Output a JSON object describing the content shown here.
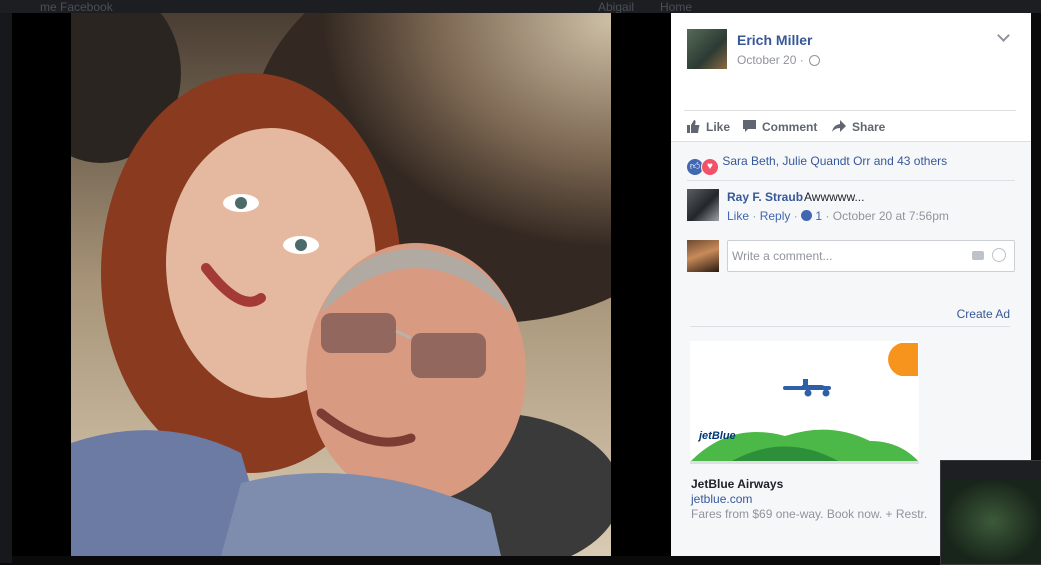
{
  "background": {
    "left_text": "me Facebook",
    "mid_text": "Abigail",
    "right_text": "Home"
  },
  "post": {
    "author": "Erich Miller",
    "date": "October 20",
    "date_sep": "·",
    "privacy_icon": "globe-icon"
  },
  "actions": {
    "like": "Like",
    "comment": "Comment",
    "share": "Share"
  },
  "reactions": {
    "summary": "Sara Beth, Julie Quandt Orr and 43 others",
    "icons": [
      "like-reaction-icon",
      "love-reaction-icon"
    ]
  },
  "comments": [
    {
      "author": "Ray F. Straub",
      "text": "Awwwww...",
      "like": "Like",
      "reply": "Reply",
      "like_count": "1",
      "timestamp": "October 20 at 7:56pm"
    }
  ],
  "composer": {
    "placeholder": "Write a comment..."
  },
  "ad": {
    "create_ad": "Create Ad",
    "logo_text": "jetBlue",
    "title": "JetBlue Airways",
    "domain": "jetblue.com",
    "description": "Fares from $69 one-way. Book now. + Restr.",
    "colors": {
      "sun": "#f7941d",
      "hills": "#4cb848",
      "plane": "#2e5fa8",
      "logo": "#003876"
    }
  },
  "colors": {
    "link": "#365899",
    "meta": "#90949c",
    "panel_bg": "#ffffff",
    "social_bg": "#f6f7f9",
    "divider": "#dddfe2"
  }
}
